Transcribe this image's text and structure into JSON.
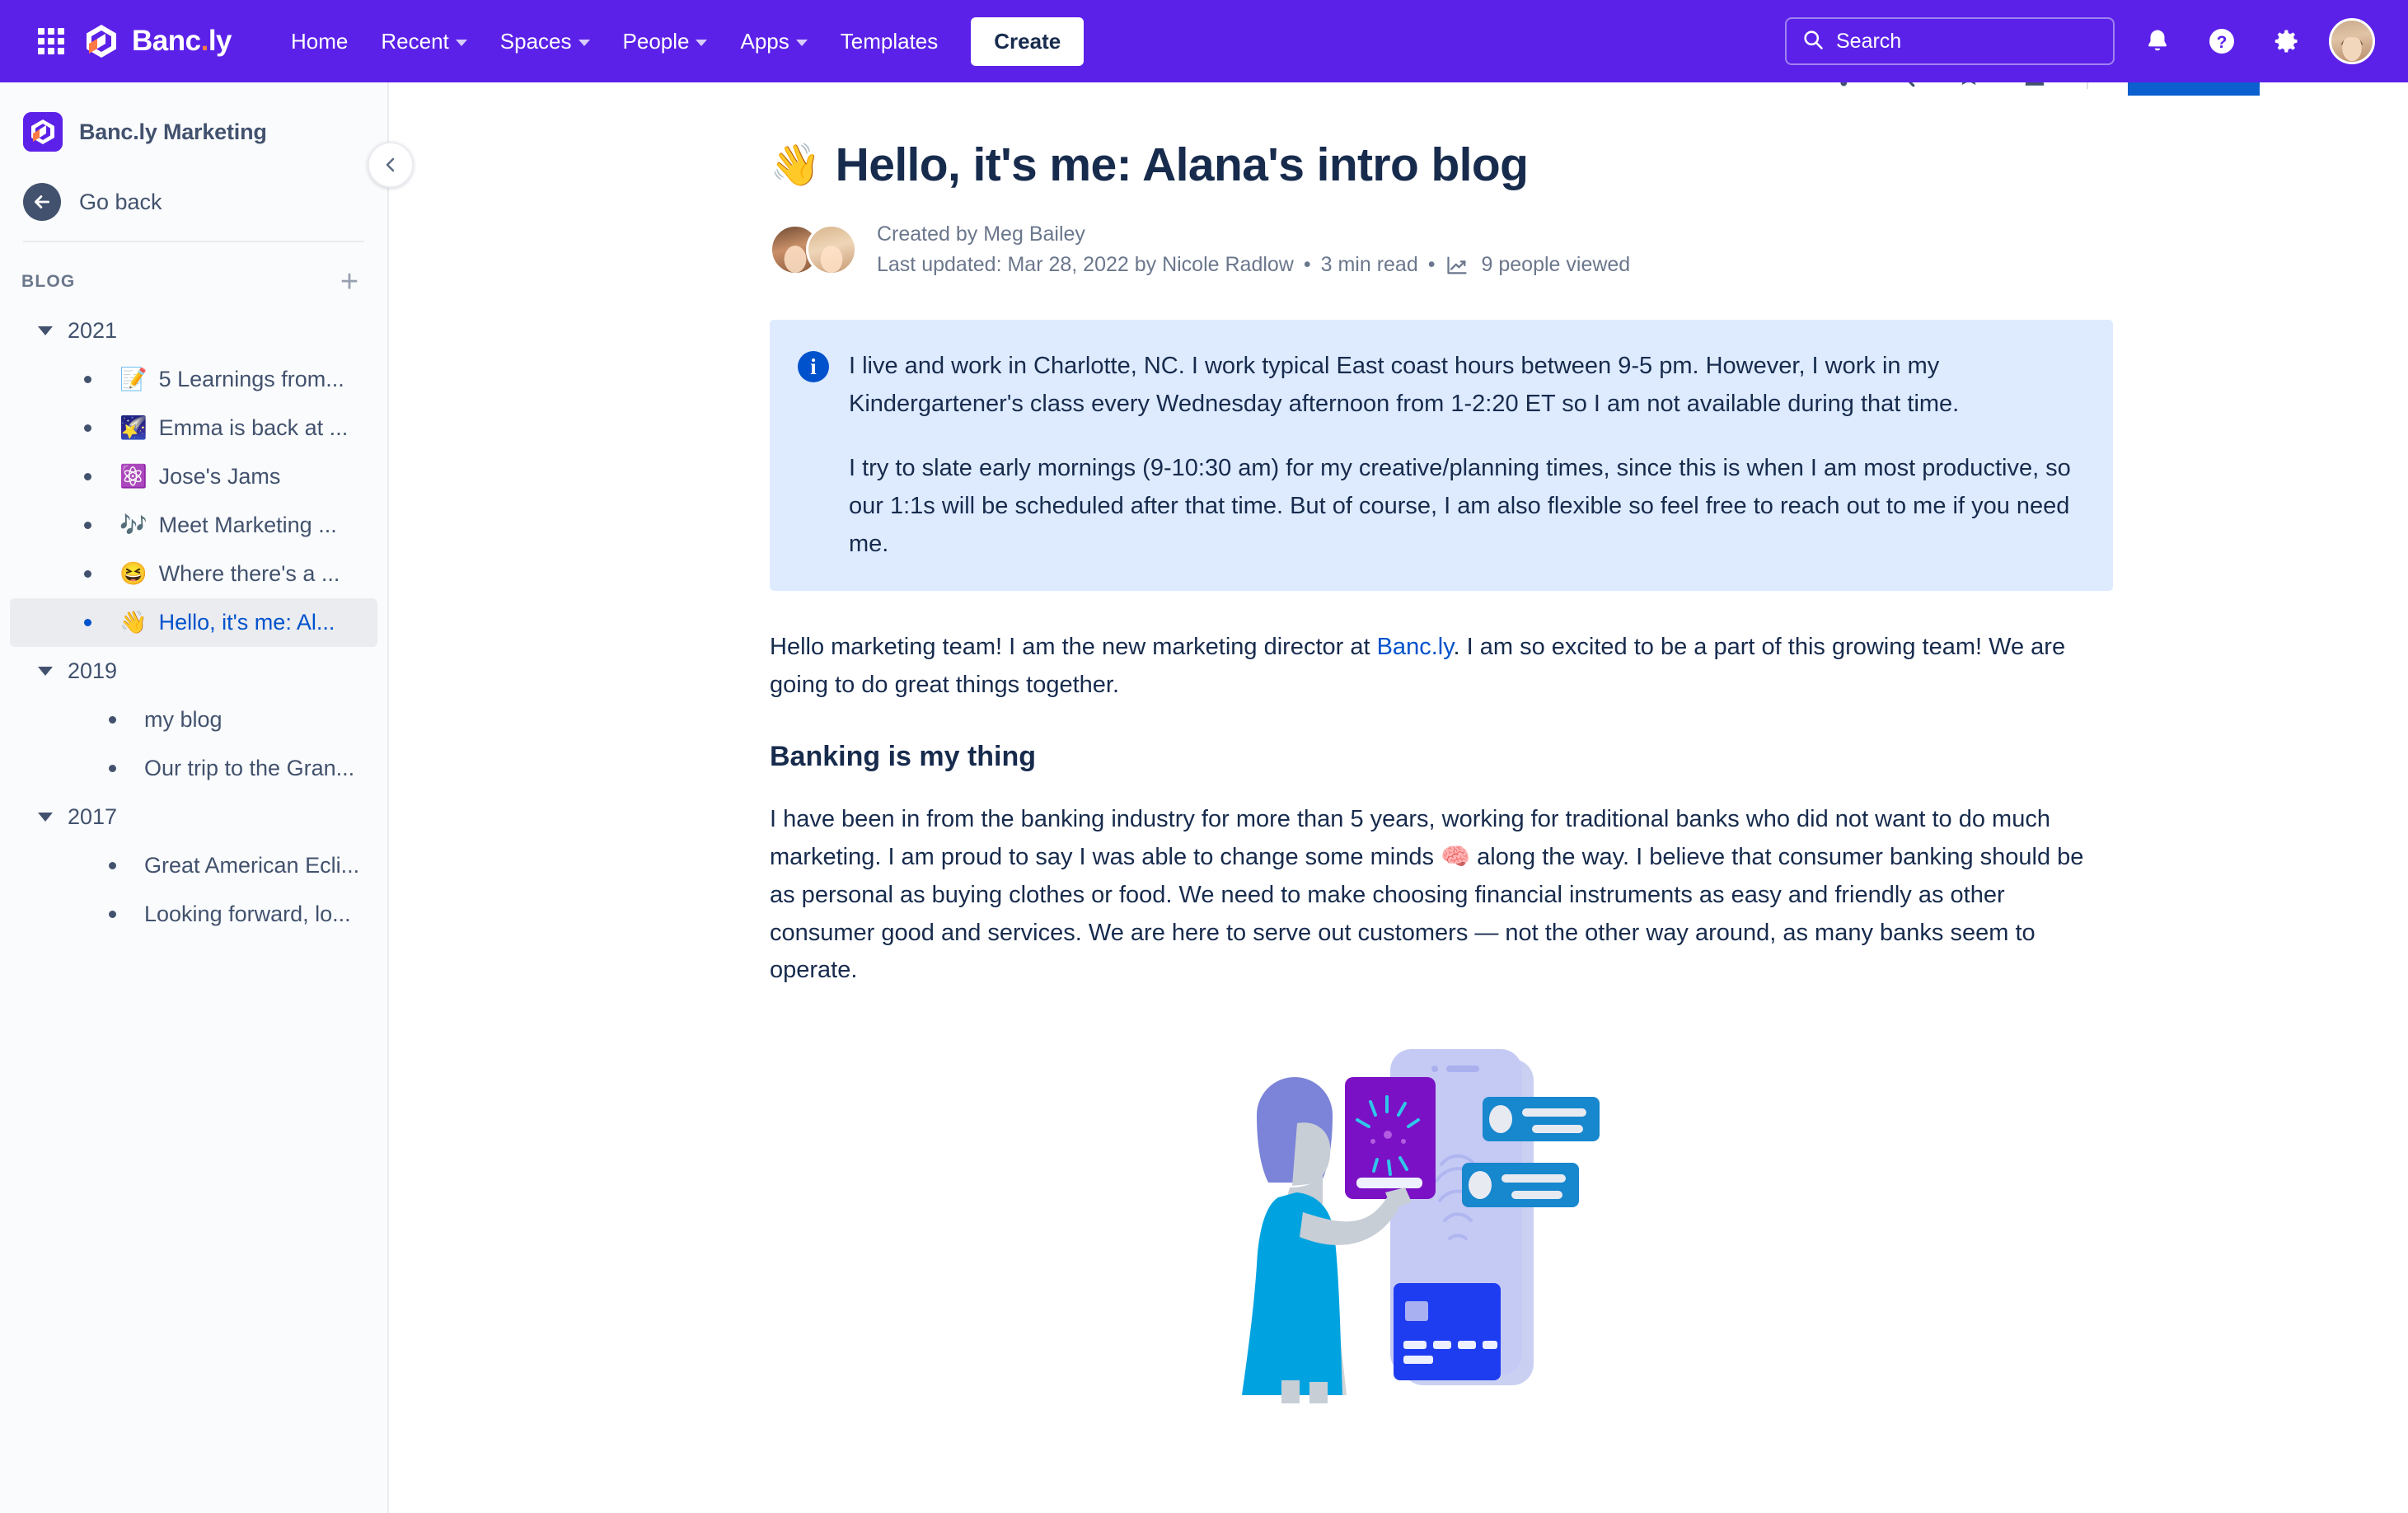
{
  "topnav": {
    "app_switcher_icon": "grid-apps-icon",
    "brand": {
      "name_main": "Banc",
      "name_dot": ".",
      "name_suffix": "ly",
      "logo_icon": "bancly-logo-icon"
    },
    "links": [
      {
        "label": "Home",
        "has_chevron": false
      },
      {
        "label": "Recent",
        "has_chevron": true
      },
      {
        "label": "Spaces",
        "has_chevron": true
      },
      {
        "label": "People",
        "has_chevron": true
      },
      {
        "label": "Apps",
        "has_chevron": true
      },
      {
        "label": "Templates",
        "has_chevron": false
      }
    ],
    "create_label": "Create",
    "search": {
      "placeholder": "Search",
      "icon": "search-icon"
    },
    "icons": [
      "notifications-bell-icon",
      "help-question-icon",
      "settings-gear-icon"
    ],
    "avatar": "user-avatar",
    "background_color": "#5B21E8"
  },
  "sidebar": {
    "space_name": "Banc.ly Marketing",
    "go_back_label": "Go back",
    "section_label": "BLOG",
    "add_button_label": "+",
    "collapse_button_icon": "chevron-left-icon",
    "tree": [
      {
        "year": "2021",
        "expanded": true,
        "items": [
          {
            "emoji": "📝",
            "label": "5 Learnings from...",
            "selected": false
          },
          {
            "emoji": "🌠",
            "label": "Emma is back at ...",
            "selected": false
          },
          {
            "emoji": "⚛️",
            "label": "Jose's Jams",
            "selected": false
          },
          {
            "emoji": "🎶",
            "label": "Meet Marketing ...",
            "selected": false
          },
          {
            "emoji": "😆",
            "label": "Where there's a ...",
            "selected": false
          },
          {
            "emoji": "👋",
            "label": "Hello, it's me: Al...",
            "selected": true
          }
        ]
      },
      {
        "year": "2019",
        "expanded": true,
        "items": [
          {
            "emoji": "",
            "label": "my blog",
            "selected": false
          },
          {
            "emoji": "",
            "label": "Our trip to the Gran...",
            "selected": false
          }
        ]
      },
      {
        "year": "2017",
        "expanded": true,
        "items": [
          {
            "emoji": "",
            "label": "Great American Ecli...",
            "selected": false
          },
          {
            "emoji": "",
            "label": "Looking forward, lo...",
            "selected": false
          }
        ]
      }
    ]
  },
  "document": {
    "title_emoji": "👋",
    "title": "Hello, it's me: Alana's intro blog",
    "created_by": "Created by Meg Bailey",
    "last_updated": "Last updated: Mar 28, 2022 by Nicole Radlow",
    "read_time": "3 min read",
    "views": "9 people viewed",
    "views_icon": "analytics-trend-icon",
    "separator": "•",
    "info_panel": {
      "icon": "info-icon",
      "background_color": "#DEEBFF",
      "paragraphs": [
        "I live and work in Charlotte, NC. I work typical East coast hours between 9-5 pm. However, I work in my Kindergartener's class every Wednesday afternoon from 1-2:20 ET so I am not available during that time.",
        "I try to slate early mornings (9-10:30 am) for my creative/planning times, since this is when I am most productive, so our 1:1s will be scheduled after that time. But of course, I am also flexible so feel free to reach out to me if you need me."
      ]
    },
    "intro_before_link": "Hello marketing team! I am the new marketing director at ",
    "intro_link": "Banc.ly",
    "intro_after_link": ". I am so excited to be a part of this growing team! We are going to do great things together.",
    "heading_banking": "Banking is my thing",
    "banking_body_part1": "I have been in from the banking industry for more than 5 years, working for traditional banks who did not want to do much marketing. I am proud to say I was able to change some minds ",
    "banking_emoji": "🧠",
    "banking_body_part2": " along the way. I believe that consumer banking should be as personal as buying clothes or food. We need to make choosing financial instruments as easy and friendly as other consumer good and services. We are here to serve out customers — not the other way around, as many banks seem to operate.",
    "illustration_name": "woman-with-phone-banking-illustration"
  },
  "colors": {
    "brand_purple": "#5B21E8",
    "link_blue": "#0052CC",
    "panel_blue": "#DEEBFF",
    "text_dark": "#172B4D",
    "text_muted": "#6B778C",
    "sidebar_bg": "#FAFBFC"
  }
}
